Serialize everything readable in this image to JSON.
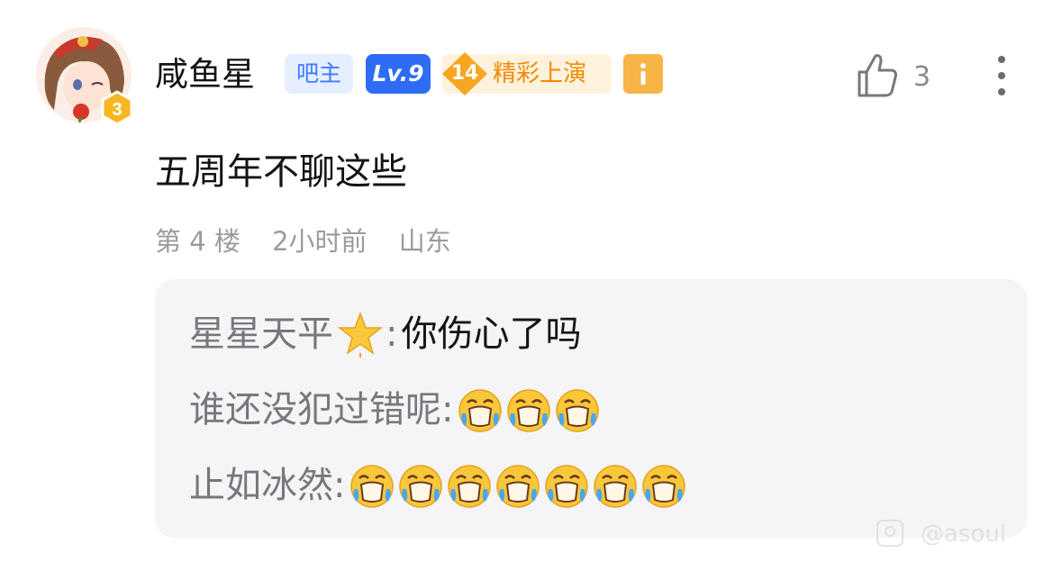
{
  "post": {
    "username": "咸鱼星",
    "tags": {
      "bazhu": "吧主",
      "level": "Lv.9",
      "rank_number": "14",
      "rank_title": "精彩上演",
      "info_icon": "info-icon"
    },
    "avatar_badge_level": "3",
    "like_count": "3",
    "content": "五周年不聊这些",
    "meta": {
      "floor": "第 4 楼",
      "time": "2小时前",
      "location": "山东"
    }
  },
  "replies": [
    {
      "name": "星星天平",
      "name_emoji": "star-emoji",
      "separator": ":",
      "text": "你伤心了吗",
      "emojis": []
    },
    {
      "name": "谁还没犯过错呢",
      "separator": ":",
      "text": "",
      "emojis": [
        "crying-emoji",
        "crying-emoji",
        "crying-emoji"
      ]
    },
    {
      "name": "止如冰然",
      "separator": ":",
      "text": "",
      "emojis": [
        "crying-emoji",
        "crying-emoji",
        "crying-emoji",
        "crying-emoji",
        "crying-emoji",
        "crying-emoji",
        "crying-emoji"
      ]
    }
  ],
  "watermark": "@asoul",
  "colors": {
    "bazhu_bg": "#e6efff",
    "bazhu_text": "#3b7bff",
    "level_bg": "#2f6cf5",
    "rank_bg": "#fff2dc",
    "rank_text": "#f28a00",
    "reply_bg": "#f5f5f8",
    "meta_text": "#9a9aa0"
  }
}
